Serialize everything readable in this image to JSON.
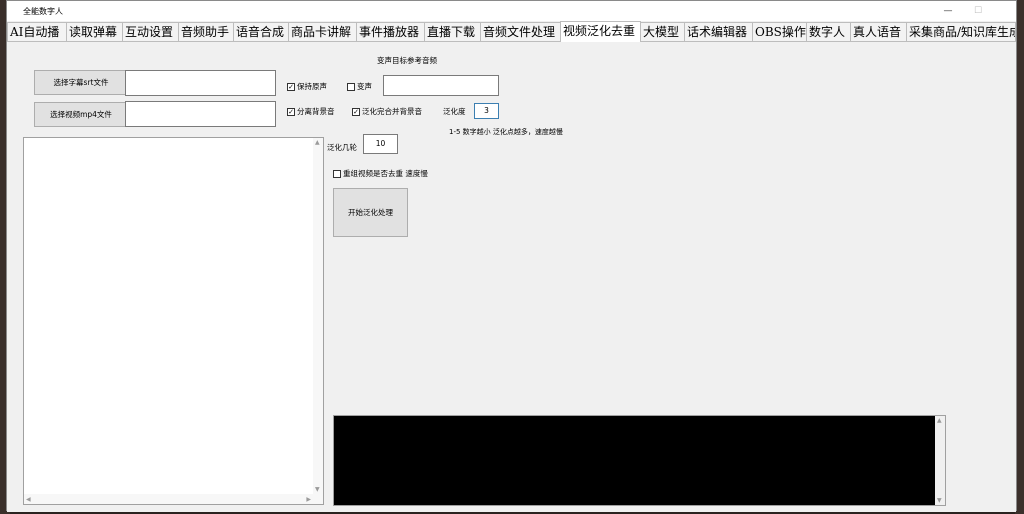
{
  "window": {
    "title": "全能数字人",
    "min_icon": "minimize-icon",
    "max_icon": "maximize-icon"
  },
  "tabs": [
    "AI自动播",
    "读取弹幕",
    "互动设置",
    "音频助手",
    "语音合成",
    "商品卡讲解",
    "事件播放器",
    "直播下载",
    "音频文件处理",
    "视频泛化去重",
    "大模型",
    "话术编辑器",
    "OBS操作",
    "数字人",
    "真人语音",
    "采集商品/知识库生成"
  ],
  "active_tab": "视频泛化去重",
  "panel": {
    "ref_audio_title": "变声目标参考音频",
    "select_srt_button": "选择字幕srt文件",
    "select_mp4_button": "选择视频mp4文件",
    "srt_path": "",
    "mp4_path": "",
    "keep_original_label": "保持原声",
    "keep_original_checked": true,
    "voice_change_label": "变声",
    "voice_change_checked": false,
    "ref_audio_path": "",
    "separate_bgm_label": "分离背景音",
    "separate_bgm_checked": true,
    "merge_bgm_label": "泛化完合并背景音",
    "merge_bgm_checked": true,
    "degree_label": "泛化度",
    "degree_value": "3",
    "degree_hint": "1-5 数字越小 泛化点越多，速度越慢",
    "rounds_label": "泛化几轮",
    "rounds_value": "10",
    "recombine_label": "重组视频是否去重 速度慢",
    "recombine_checked": false,
    "start_button": "开始泛化处理"
  },
  "colors": {
    "window_bg": "#f0f0f0",
    "log_bg": "#000000",
    "active_tab": "#ffffff"
  }
}
